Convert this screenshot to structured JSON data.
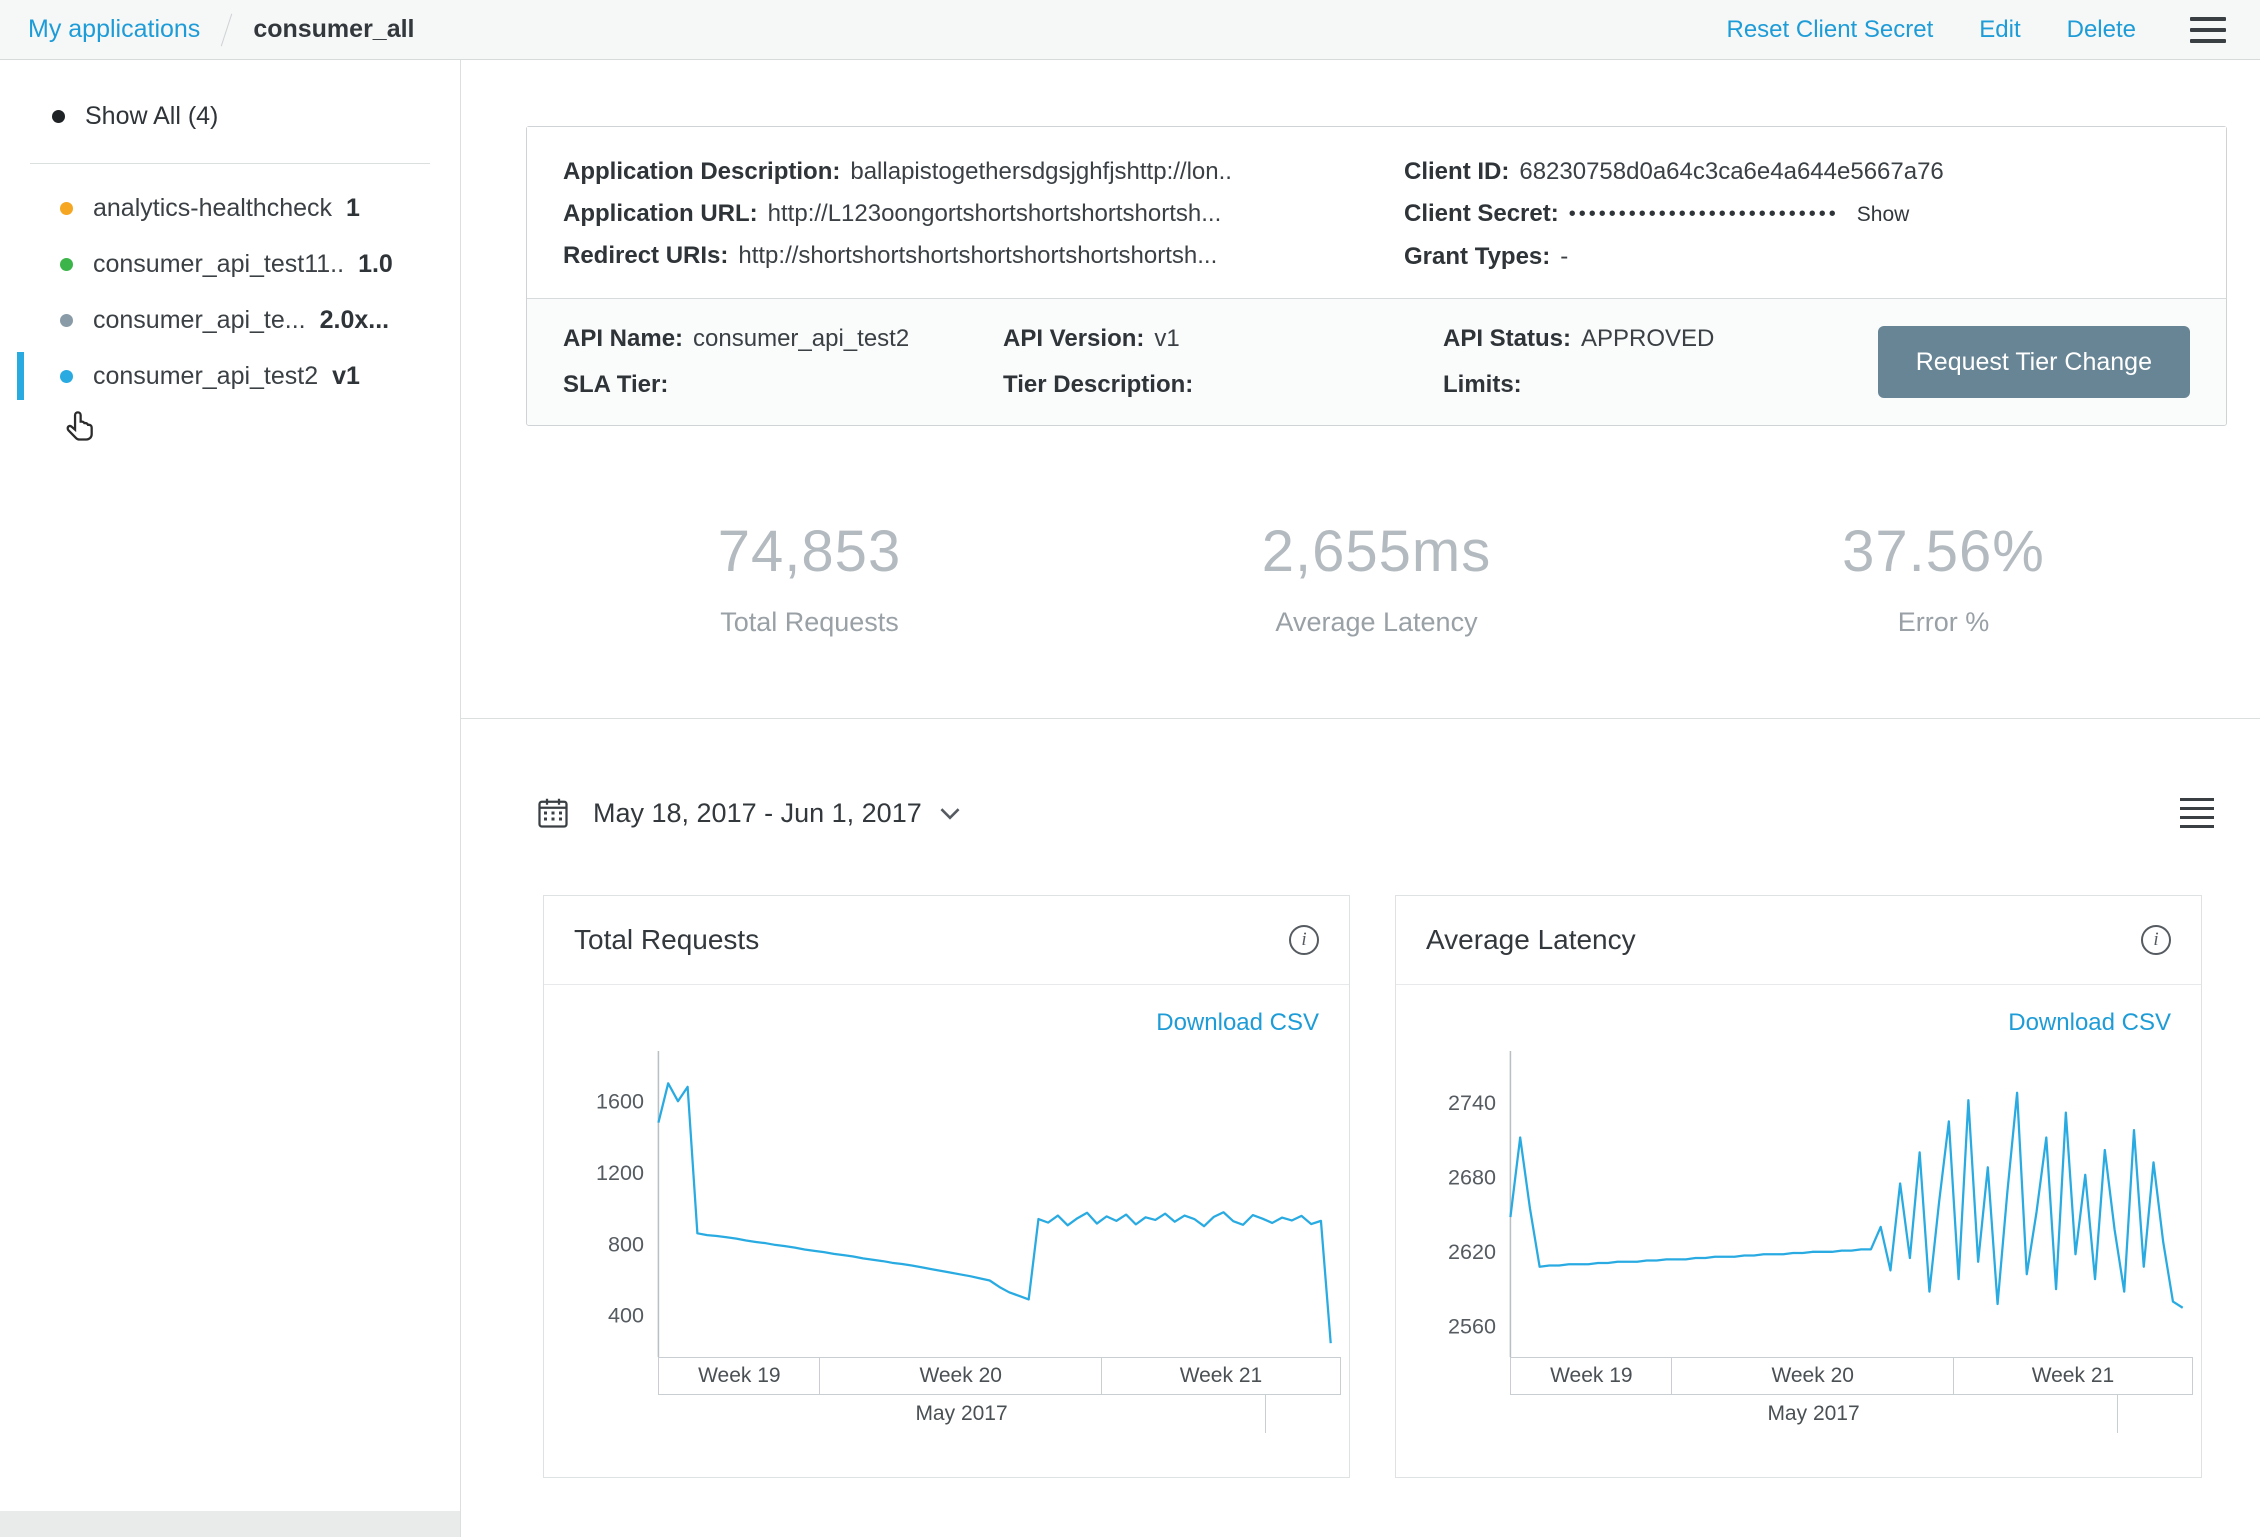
{
  "topbar": {
    "breadcrumb": "My applications",
    "title": "consumer_all",
    "actions": {
      "reset": "Reset Client Secret",
      "edit": "Edit",
      "delete": "Delete"
    }
  },
  "sidebar": {
    "show_all": "Show All (4)",
    "items": [
      {
        "name": "analytics-healthcheck",
        "version": "1",
        "color": "#f5a623",
        "selected": false
      },
      {
        "name": "consumer_api_test11..",
        "version": "1.0",
        "color": "#3bb54a",
        "selected": false
      },
      {
        "name": "consumer_api_te...",
        "version": "2.0x...",
        "color": "#8a9ba8",
        "selected": false
      },
      {
        "name": "consumer_api_test2",
        "version": "v1",
        "color": "#29abe2",
        "selected": true
      }
    ]
  },
  "app_details": {
    "description_label": "Application Description:",
    "description_value": "ballapistogethersdgsjghfjshttp://lon..",
    "url_label": "Application URL:",
    "url_value": "http://L123oongortshortshortshortshortsh...",
    "redirect_label": "Redirect URIs:",
    "redirect_value": "http://shortshortshortshortshortshortshortsh...",
    "client_id_label": "Client ID:",
    "client_id_value": "68230758d0a64c3ca6e4a644e5667a76",
    "client_secret_label": "Client Secret:",
    "client_secret_masked": "•••••••••••••••••••••••••••",
    "show_button": "Show",
    "grant_types_label": "Grant Types:",
    "grant_types_value": "-"
  },
  "api_details": {
    "name_label": "API Name:",
    "name_value": "consumer_api_test2",
    "version_label": "API Version:",
    "version_value": "v1",
    "status_label": "API Status:",
    "status_value": "APPROVED",
    "sla_label": "SLA Tier:",
    "tier_desc_label": "Tier Description:",
    "limits_label": "Limits:",
    "request_button": "Request Tier Change"
  },
  "stats": [
    {
      "value": "74,853",
      "label": "Total Requests"
    },
    {
      "value": "2,655ms",
      "label": "Average Latency"
    },
    {
      "value": "37.56%",
      "label": "Error %"
    }
  ],
  "date_filter": {
    "range": "May 18, 2017 - Jun 1, 2017"
  },
  "charts_common": {
    "download": "Download CSV",
    "weeks": [
      "Week 19",
      "Week 20",
      "Week 21"
    ],
    "month": "May 2017"
  },
  "icons": {
    "info": "i"
  },
  "chart_data": [
    {
      "type": "line",
      "title": "Total Requests",
      "line_color": "#29abe2",
      "ylim": [
        200,
        1800
      ],
      "yticks": [
        400,
        800,
        1200,
        1600
      ],
      "x_axis": {
        "weeks": [
          "Week 19",
          "Week 20",
          "Week 21"
        ],
        "month": "May 2017"
      },
      "values": [
        1480,
        1700,
        1600,
        1680,
        860,
        850,
        845,
        838,
        830,
        820,
        812,
        805,
        795,
        788,
        780,
        770,
        762,
        755,
        745,
        738,
        730,
        720,
        712,
        705,
        695,
        688,
        680,
        670,
        660,
        650,
        640,
        630,
        620,
        608,
        596,
        560,
        530,
        510,
        490,
        940,
        920,
        960,
        905,
        945,
        975,
        915,
        955,
        930,
        965,
        910,
        950,
        935,
        970,
        925,
        960,
        940,
        900,
        952,
        978,
        928,
        908,
        962,
        942,
        918,
        948,
        932,
        958,
        912,
        930,
        245
      ]
    },
    {
      "type": "line",
      "title": "Average Latency",
      "line_color": "#29abe2",
      "ylim": [
        2540,
        2770
      ],
      "yticks": [
        2560,
        2620,
        2680,
        2740
      ],
      "x_axis": {
        "weeks": [
          "Week 19",
          "Week 20",
          "Week 21"
        ],
        "month": "May 2017"
      },
      "values": [
        2648,
        2712,
        2655,
        2608,
        2609,
        2609,
        2610,
        2610,
        2610,
        2611,
        2611,
        2612,
        2612,
        2612,
        2613,
        2613,
        2614,
        2614,
        2614,
        2615,
        2615,
        2616,
        2616,
        2616,
        2617,
        2617,
        2618,
        2618,
        2618,
        2619,
        2619,
        2620,
        2620,
        2620,
        2621,
        2621,
        2622,
        2622,
        2640,
        2605,
        2675,
        2615,
        2700,
        2588,
        2660,
        2725,
        2598,
        2742,
        2612,
        2688,
        2578,
        2668,
        2748,
        2602,
        2652,
        2712,
        2590,
        2732,
        2618,
        2682,
        2598,
        2702,
        2638,
        2588,
        2718,
        2608,
        2692,
        2628,
        2580,
        2575
      ]
    }
  ]
}
